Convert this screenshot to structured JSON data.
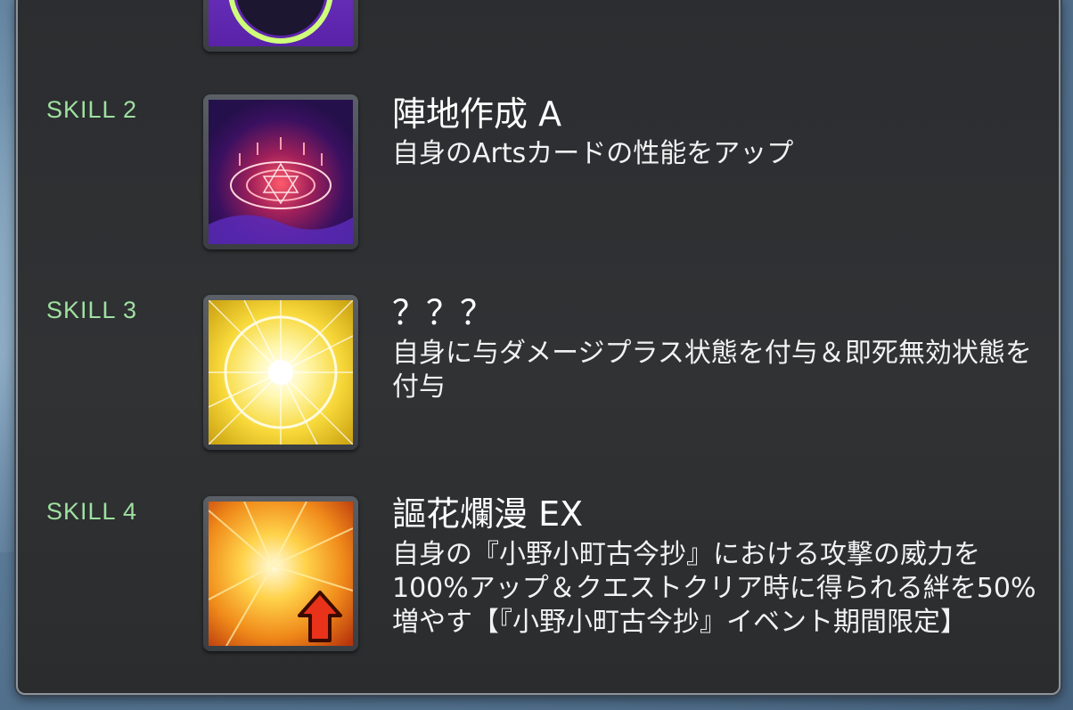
{
  "skills": [
    {
      "label": "SKILL 2",
      "name": "陣地作成 A",
      "description": "自身のArtsカードの性能をアップ",
      "icon": "magic-circle-icon"
    },
    {
      "label": "SKILL 3",
      "name": "？？？",
      "description": "自身に与ダメージプラス状態を付与＆即死無効状態を付与",
      "icon": "light-burst-icon"
    },
    {
      "label": "SKILL 4",
      "name": "謳花爛漫 EX",
      "description": "自身の『小野小町古今抄』における攻撃の威力を100%アップ＆クエストクリア時に得られる絆を50%増やす【『小野小町古今抄』イベント期間限定】",
      "icon": "explosion-up-arrow-icon"
    }
  ],
  "colors": {
    "skill_label": "#9fe0a0",
    "panel_bg": "#2e3032",
    "text": "#ffffff"
  }
}
